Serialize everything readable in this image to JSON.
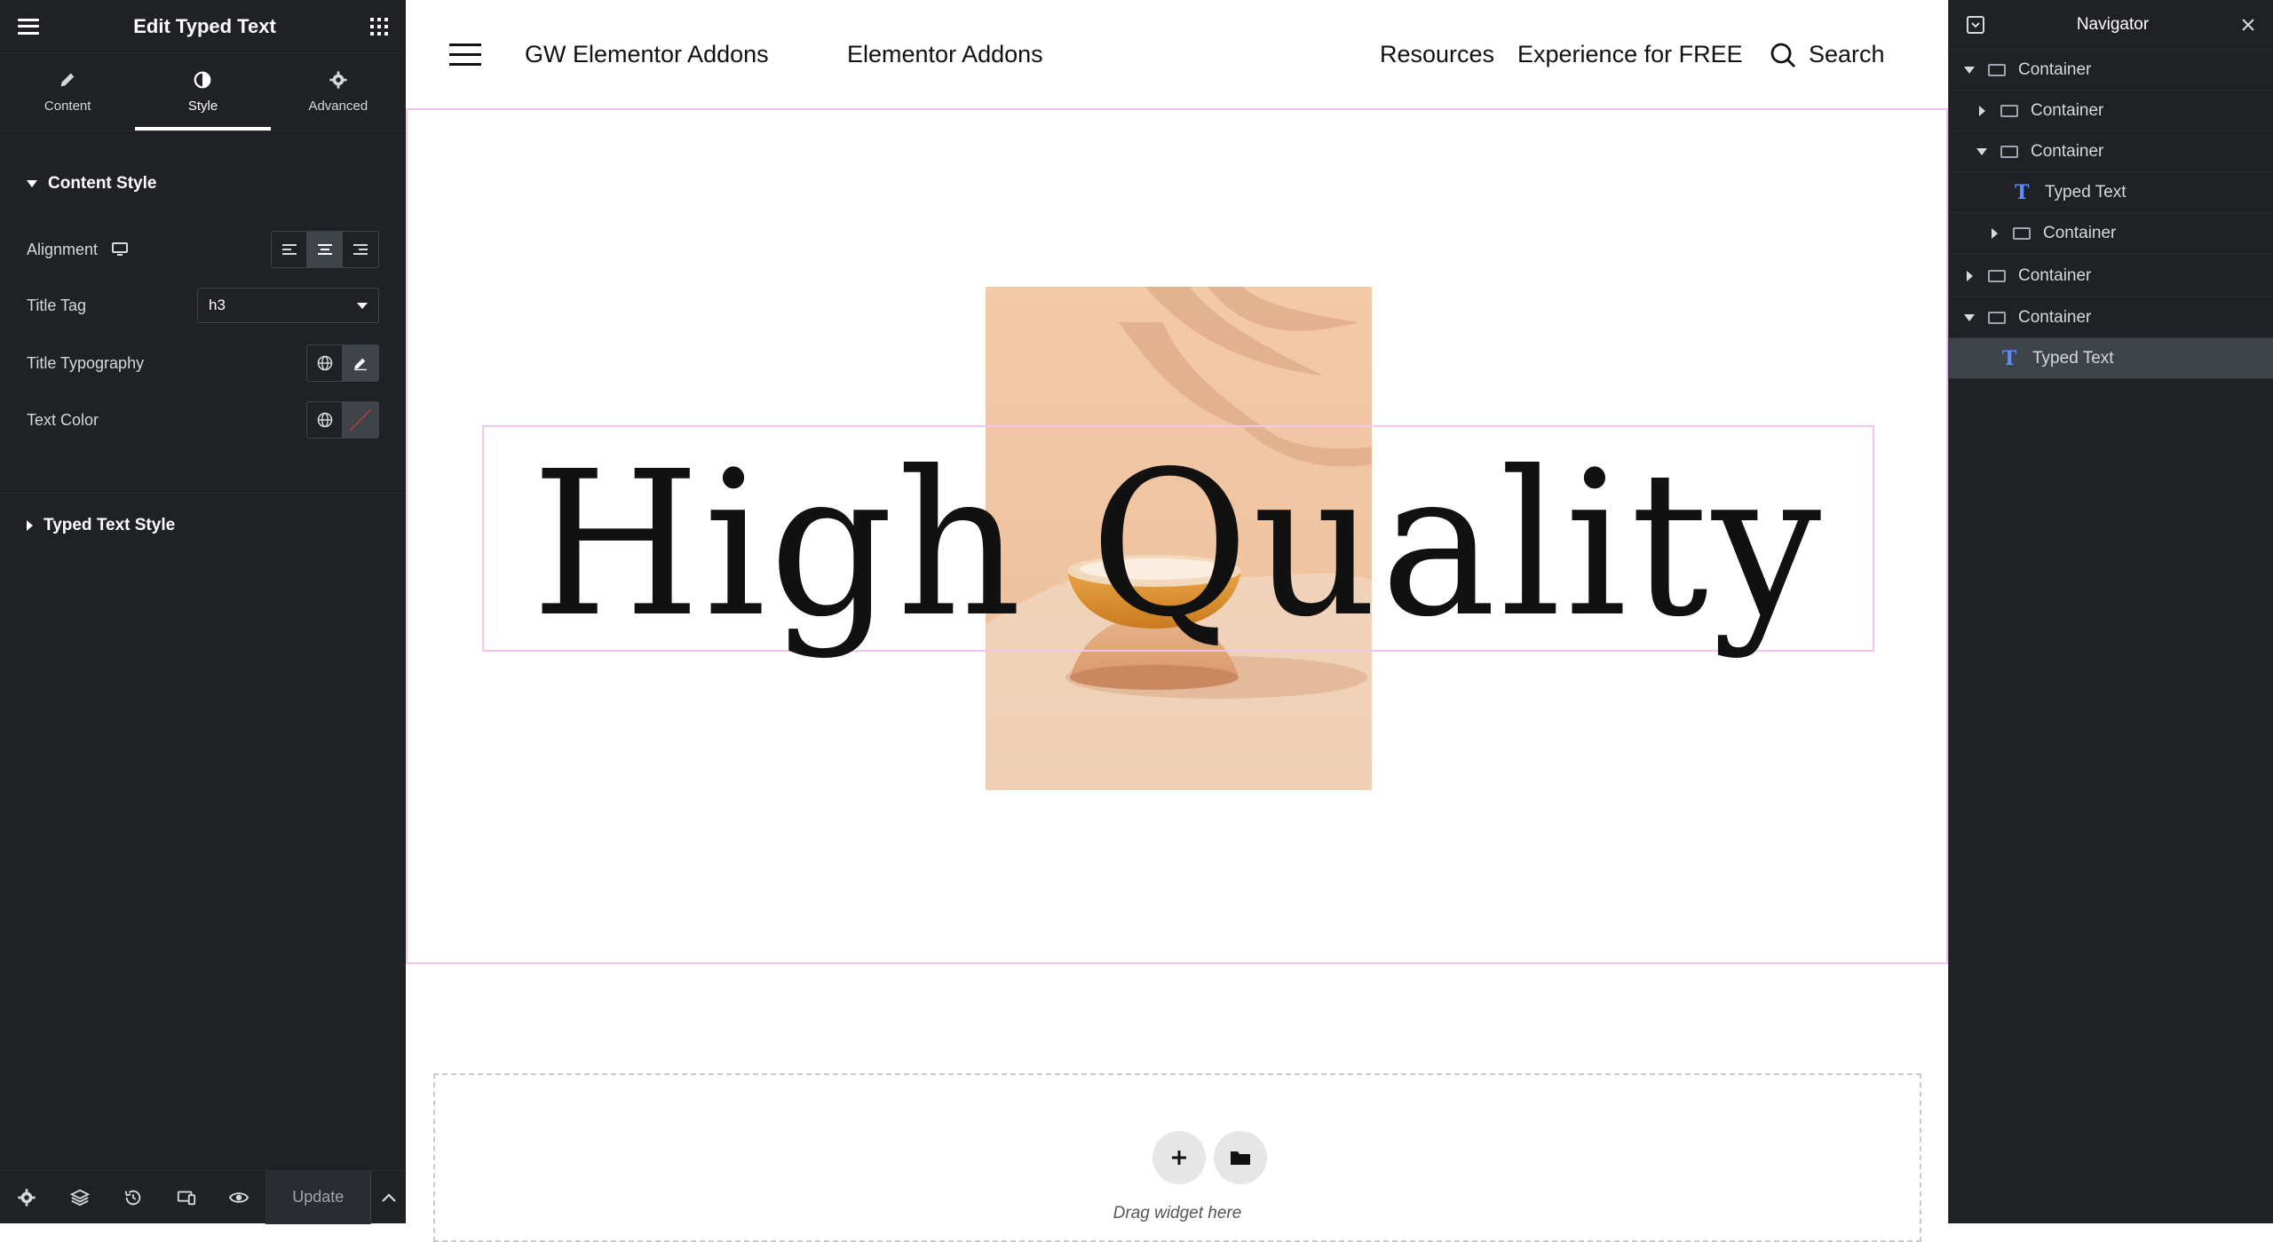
{
  "panel": {
    "title": "Edit Typed Text",
    "tabs": [
      {
        "label": "Content",
        "icon": "pencil-icon"
      },
      {
        "label": "Style",
        "icon": "half-circle-icon"
      },
      {
        "label": "Advanced",
        "icon": "gear-icon"
      }
    ],
    "active_tab": "Style",
    "content_style": {
      "heading": "Content Style",
      "alignment_label": "Alignment",
      "alignment_selected": "center",
      "title_tag_label": "Title Tag",
      "title_tag_value": "h3",
      "title_typography_label": "Title Typography",
      "text_color_label": "Text Color"
    },
    "typed_text_style_heading": "Typed Text Style",
    "footer": {
      "update_label": "Update"
    }
  },
  "site": {
    "brand": "GW Elementor Addons",
    "nav_link_1": "Elementor Addons",
    "nav_link_2": "Resources",
    "nav_link_3": "Experience for FREE",
    "search_label": "Search"
  },
  "hero": {
    "typed_text": "High Quality"
  },
  "drop_zone": {
    "text": "Drag widget here"
  },
  "navigator": {
    "title": "Navigator",
    "items": [
      {
        "label": "Container",
        "type": "container",
        "caret": "down"
      },
      {
        "label": "Container",
        "type": "container",
        "caret": "right"
      },
      {
        "label": "Container",
        "type": "container",
        "caret": "down"
      },
      {
        "label": "Typed Text",
        "type": "typed-text",
        "caret": "none"
      },
      {
        "label": "Container",
        "type": "container",
        "caret": "right"
      },
      {
        "label": "Container",
        "type": "container",
        "caret": "right"
      },
      {
        "label": "Container",
        "type": "container",
        "caret": "down"
      },
      {
        "label": "Typed Text",
        "type": "typed-text",
        "caret": "none"
      }
    ]
  },
  "colors": {
    "panel_bg": "#1f2124",
    "selection_outline": "#f1c6ee",
    "accent_icon": "#5d8bff"
  }
}
